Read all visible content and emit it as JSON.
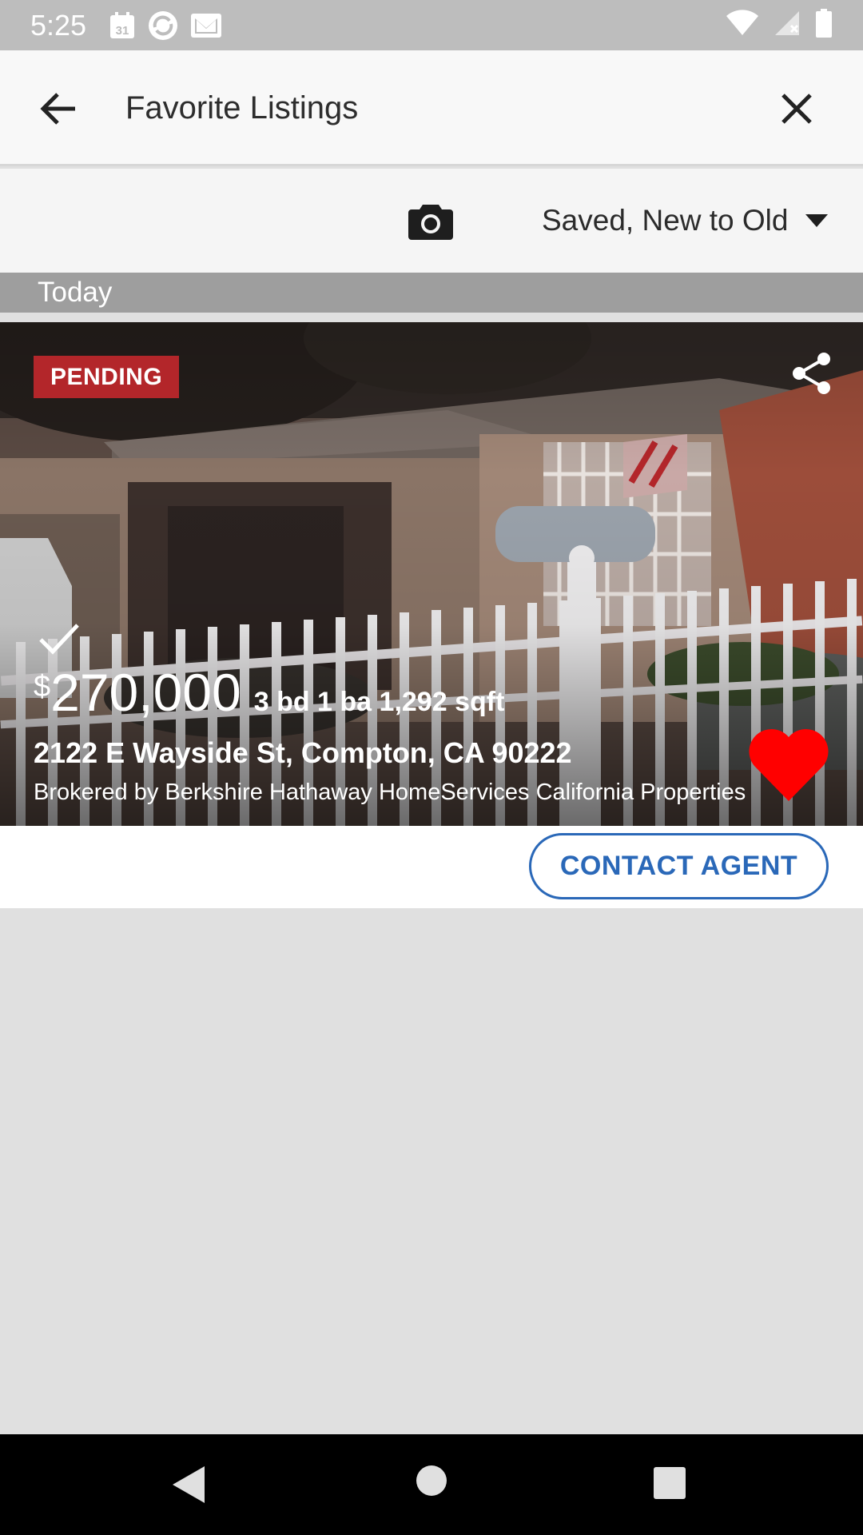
{
  "status_bar": {
    "time": "5:25",
    "calendar_day": "31"
  },
  "app_bar": {
    "title": "Favorite Listings"
  },
  "toolbar": {
    "sort_label": "Saved, New to Old"
  },
  "section": {
    "header": "Today"
  },
  "listing": {
    "status_badge": "PENDING",
    "price_currency": "$",
    "price": "270,000",
    "specs": "3 bd 1 ba 1,292 sqft",
    "address": "2122 E Wayside St, Compton, CA 90222",
    "broker": "Brokered by Berkshire Hathaway HomeServices California Properties -",
    "contact_label": "CONTACT AGENT",
    "favorited": true
  },
  "colors": {
    "badge": "#b3262a",
    "accent": "#2a68b8",
    "heart": "#ff0000"
  },
  "icons": [
    "back-arrow-icon",
    "close-icon",
    "camera-icon",
    "dropdown-arrow-icon",
    "share-icon",
    "check-icon",
    "heart-icon"
  ]
}
